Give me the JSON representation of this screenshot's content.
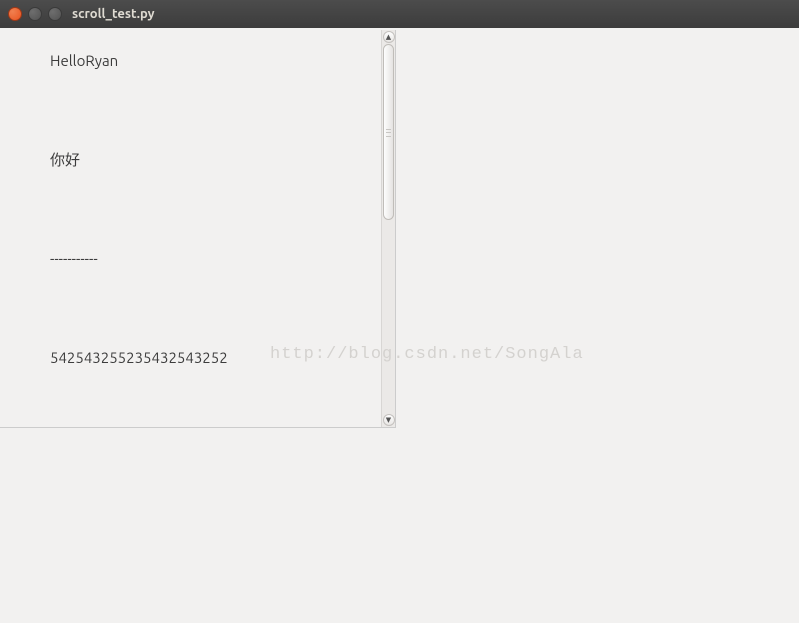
{
  "window": {
    "title": "scroll_test.py"
  },
  "content": {
    "lines": [
      "HelloRyan",
      "你好",
      "-----------",
      "542543255235432543252"
    ]
  },
  "watermark": {
    "text": "http://blog.csdn.net/SongAla"
  }
}
